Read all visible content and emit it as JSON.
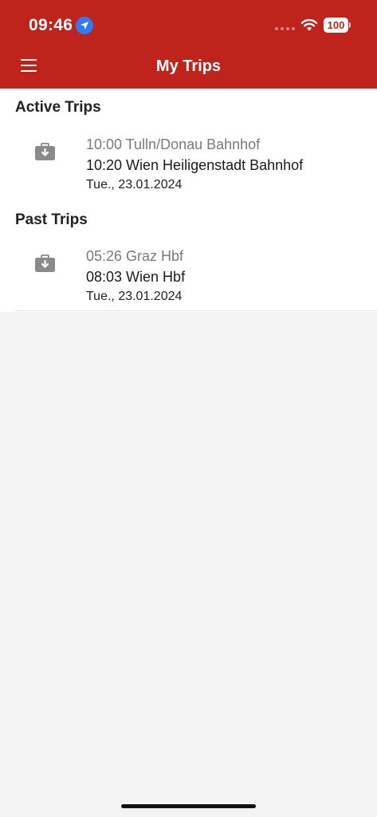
{
  "status_bar": {
    "time": "09:46",
    "battery": "100"
  },
  "nav": {
    "title": "My Trips"
  },
  "sections": [
    {
      "title": "Active Trips",
      "trips": [
        {
          "departure": "10:00 Tulln/Donau Bahnhof",
          "arrival": "10:20 Wien Heiligenstadt Bahnhof",
          "date": "Tue., 23.01.2024"
        }
      ]
    },
    {
      "title": "Past Trips",
      "trips": [
        {
          "departure": "05:26 Graz Hbf",
          "arrival": "08:03 Wien Hbf",
          "date": "Tue., 23.01.2024"
        }
      ]
    }
  ],
  "colors": {
    "brand_red": "#be241c",
    "location_blue": "#2f7bf5",
    "background": "#f3f3f3"
  },
  "icons": {
    "menu": "hamburger-menu-icon",
    "trip": "briefcase-download-icon",
    "location": "location-arrow-icon",
    "wifi": "wifi-icon",
    "battery": "battery-icon"
  }
}
